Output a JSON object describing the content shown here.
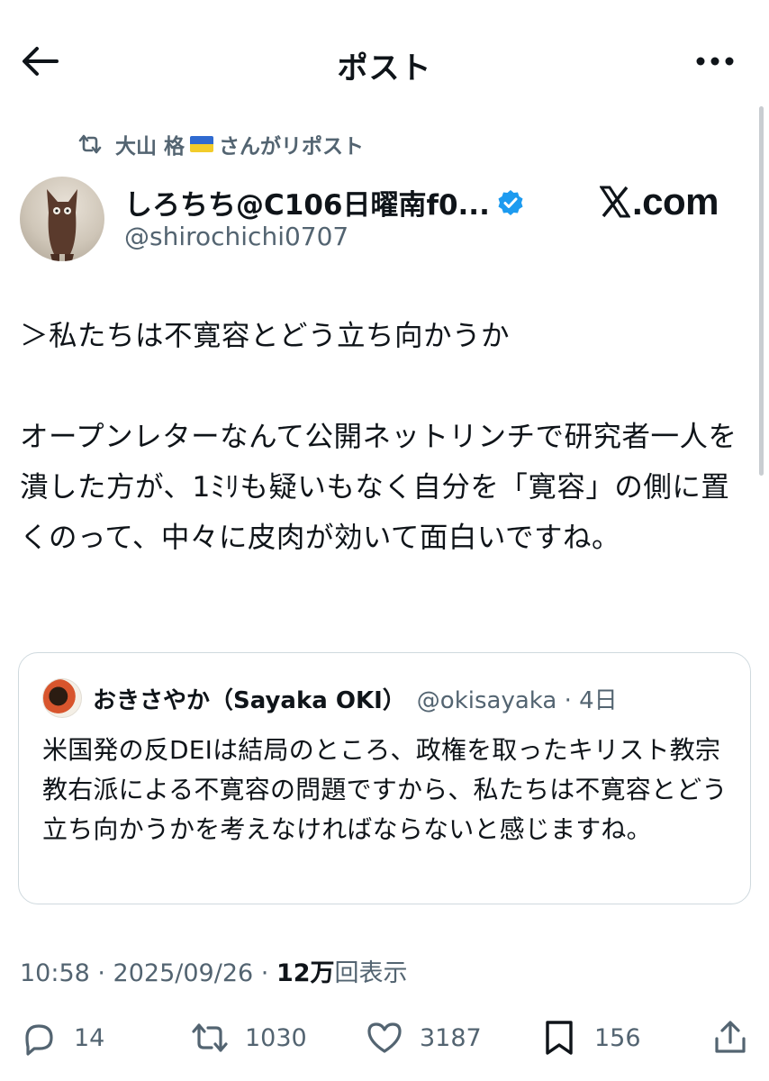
{
  "header": {
    "title": "ポスト"
  },
  "repost": {
    "user": "大山 格",
    "suffix": "さんがリポスト"
  },
  "author": {
    "name": "しろちち@C106日曜南f0...",
    "handle": "@shirochichi0707"
  },
  "watermark": "com",
  "tweet": {
    "text": "＞私たちは不寛容とどう立ち向かうか\n\nオープンレターなんて公開ネットリンチで研究者一人を潰した方が、1ﾐﾘも疑いもなく自分を「寛容」の側に置くのって、中々に皮肉が効いて面白いですね。"
  },
  "quote": {
    "name": "おきさやか（Sayaka OKI）",
    "meta": "@okisayaka · 4日",
    "text": "米国発の反DEIは結局のところ、政権を取ったキリスト教宗教右派による不寛容の問題ですから、私たちは不寛容とどう立ち向かうかを考えなければならないと感じますね。"
  },
  "meta": {
    "time": "10:58 · 2025/09/26 · ",
    "views": "12万",
    "views_label": "回表示"
  },
  "actions": {
    "replies": "14",
    "reposts": "1030",
    "likes": "3187",
    "bookmarks": "156"
  },
  "colors": {
    "text": "#0f1419",
    "secondary": "#536471",
    "verified": "#1d9bf0",
    "border": "#cfd9de"
  },
  "icons": [
    "back-arrow-icon",
    "more-icon",
    "repost-icon",
    "ukraine-flag-icon",
    "verified-badge-icon",
    "x-logo-icon",
    "reply-icon",
    "bookmark-icon",
    "like-icon",
    "share-icon"
  ]
}
